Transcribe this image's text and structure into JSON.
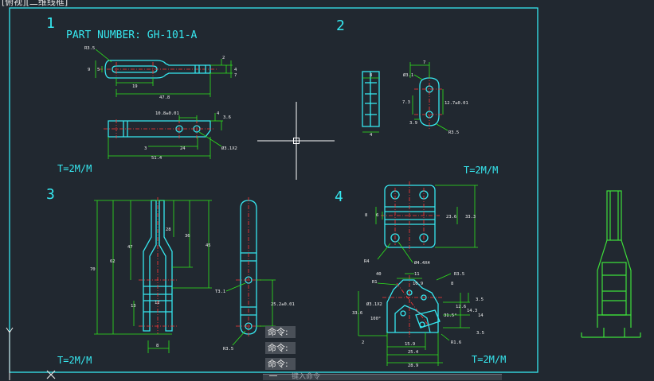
{
  "viewport": {
    "title": "[俯视][二维线框]"
  },
  "frame": {
    "quadrant_numbers": [
      "1",
      "2",
      "3",
      "4"
    ],
    "part_number": "PART NUMBER: GH-101-A",
    "thickness_labels": [
      "T=2M/M",
      "T=2M/M",
      "T=2M/M",
      "T=2M/M"
    ]
  },
  "dimensions": {
    "view1": [
      "R3.5",
      "9",
      "5",
      "2",
      "4",
      "7",
      "19",
      "47.8",
      "10.8±0.01",
      "4",
      "3.6",
      "3",
      "24",
      "Ø3.1X2",
      "51.4"
    ],
    "view2": [
      "8",
      "4",
      "7",
      "Ø3.1",
      "7.3",
      "12.7±0.01",
      "3.9",
      "R3.5"
    ],
    "view3": [
      "70",
      "62",
      "47",
      "28",
      "36",
      "45",
      "13",
      "12",
      "8",
      "T3.1",
      "25.2±0.01",
      "R3.5"
    ],
    "view4": [
      "8",
      "6",
      "23.6",
      "33.3",
      "R4",
      "Ø4.4X4",
      "40",
      "11",
      "R1",
      "10.9",
      "R3.5",
      "Ø3.1X2",
      "8",
      "12.6",
      "14.3",
      "3.5",
      "33.6",
      "100°",
      "31.5°",
      "14",
      "3.5",
      "2",
      "R1.6",
      "15.9",
      "25.4",
      "28.9"
    ]
  },
  "command_history": [
    "命令:",
    "命令:",
    "命令:"
  ],
  "command_input_placeholder": "键入命令",
  "colors": {
    "background": "#212830",
    "frame": "#36e8f0",
    "geometry": "#36e8f0",
    "dimension": "#2ee81c",
    "center": "#ff3838",
    "part": "#3ee03a",
    "crosshair": "#ffffff"
  },
  "icons": [
    "ucs-y-axis-icon",
    "ucs-x-axis-icon",
    "crosshair-cursor-icon",
    "command-line-icon"
  ]
}
